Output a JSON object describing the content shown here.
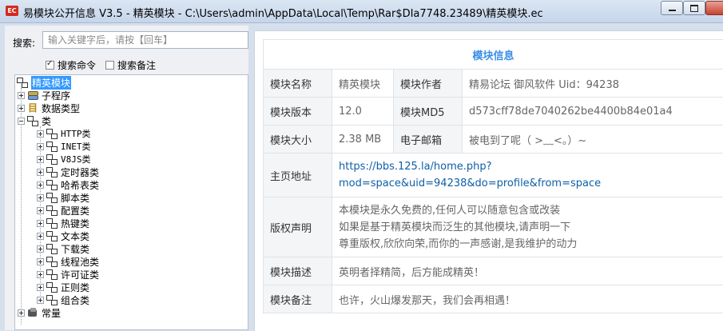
{
  "window": {
    "title": "易模块公开信息 V3.5 - 精英模块 - C:\\Users\\admin\\AppData\\Local\\Temp\\Rar$DIa7748.23489\\精英模块.ec",
    "icon_text": "EC"
  },
  "search": {
    "label": "搜索:",
    "placeholder": "输入关键字后，请按【回车】",
    "value": "",
    "opt_commands": {
      "label": "搜索命令",
      "checked": true
    },
    "opt_notes": {
      "label": "搜索备注",
      "checked": false
    }
  },
  "tree": {
    "root": "精英模块",
    "items": [
      {
        "label": "子程序",
        "icon": "stack-icon"
      },
      {
        "label": "数据类型",
        "icon": "datatype-icon"
      },
      {
        "label": "类",
        "icon": "tree-icon"
      }
    ],
    "classes": [
      "HTTP类",
      "INET类",
      "V8JS类",
      "定时器类",
      "哈希表类",
      "脚本类",
      "配置类",
      "热键类",
      "文本类",
      "下载类",
      "线程池类",
      "许可证类",
      "正则类",
      "组合类"
    ],
    "last": {
      "label": "常量",
      "icon": "constant-icon"
    }
  },
  "info": {
    "header": "模块信息",
    "name_label": "模块名称",
    "name": "精英模块",
    "author_label": "模块作者",
    "author": "精易论坛 御风软件 Uid：94238",
    "version_label": "模块版本",
    "version": "12.0",
    "md5_label": "模块MD5",
    "md5": "d573cff78de7040262be4400b84e01a4",
    "size_label": "模块大小",
    "size": "2.38 MB",
    "email_label": "电子邮箱",
    "email": "被电到了呢（ >﹏<。）~",
    "homepage_label": "主页地址",
    "homepage_line1": "https://bbs.125.la/home.php?",
    "homepage_line2": "mod=space&uid=94238&do=profile&from=space",
    "copyright_label": "版权声明",
    "copyright_line1": "本模块是永久免费的,任何人可以随意包含或改装",
    "copyright_line2": "如果是基于精英模块而泛生的其他模块,请声明一下",
    "copyright_line3": "尊重版权,欣欣向荣,而你的一声感谢,是我维护的动力",
    "desc_label": "模块描述",
    "desc": "英明者择精简，后方能成精英！",
    "note_label": "模块备注",
    "note": "也许，火山爆发那天，我们会再相遇！"
  }
}
